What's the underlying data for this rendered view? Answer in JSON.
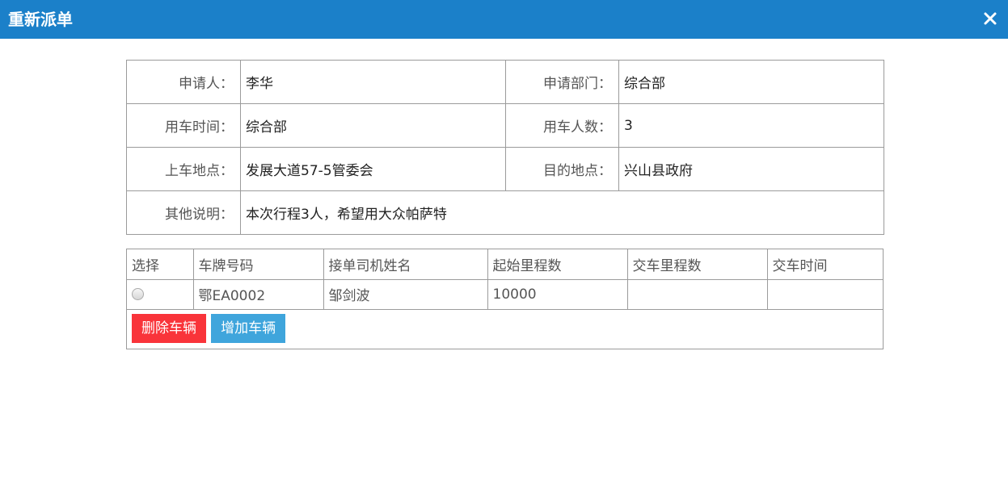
{
  "window": {
    "title": "重新派单",
    "close_symbol": "✕"
  },
  "info": {
    "applicant_label": "申请人：",
    "applicant_value": "李华",
    "department_label": "申请部门：",
    "department_value": "综合部",
    "use_time_label": "用车时间：",
    "use_time_value": "综合部",
    "passengers_label": "用车人数：",
    "passengers_value": "3",
    "pickup_label": "上车地点：",
    "pickup_value": "发展大道57-5管委会",
    "destination_label": "目的地点：",
    "destination_value": "兴山县政府",
    "notes_label": "其他说明：",
    "notes_value": "本次行程3人，希望用大众帕萨特"
  },
  "vehicles": {
    "headers": [
      "选择",
      "车牌号码",
      "接单司机姓名",
      "起始里程数",
      "交车里程数",
      "交车时间"
    ],
    "rows": [
      {
        "selected": false,
        "plate": "鄂EA0002",
        "driver": "邹剑波",
        "start_mileage": "10000",
        "return_mileage": "",
        "return_time": ""
      }
    ],
    "delete_button": "删除车辆",
    "add_button": "增加车辆"
  },
  "colors": {
    "titlebar": "#1b80c9",
    "delete_button": "#f9343a",
    "add_button": "#3fa5dc",
    "border": "#9b9b9b"
  }
}
